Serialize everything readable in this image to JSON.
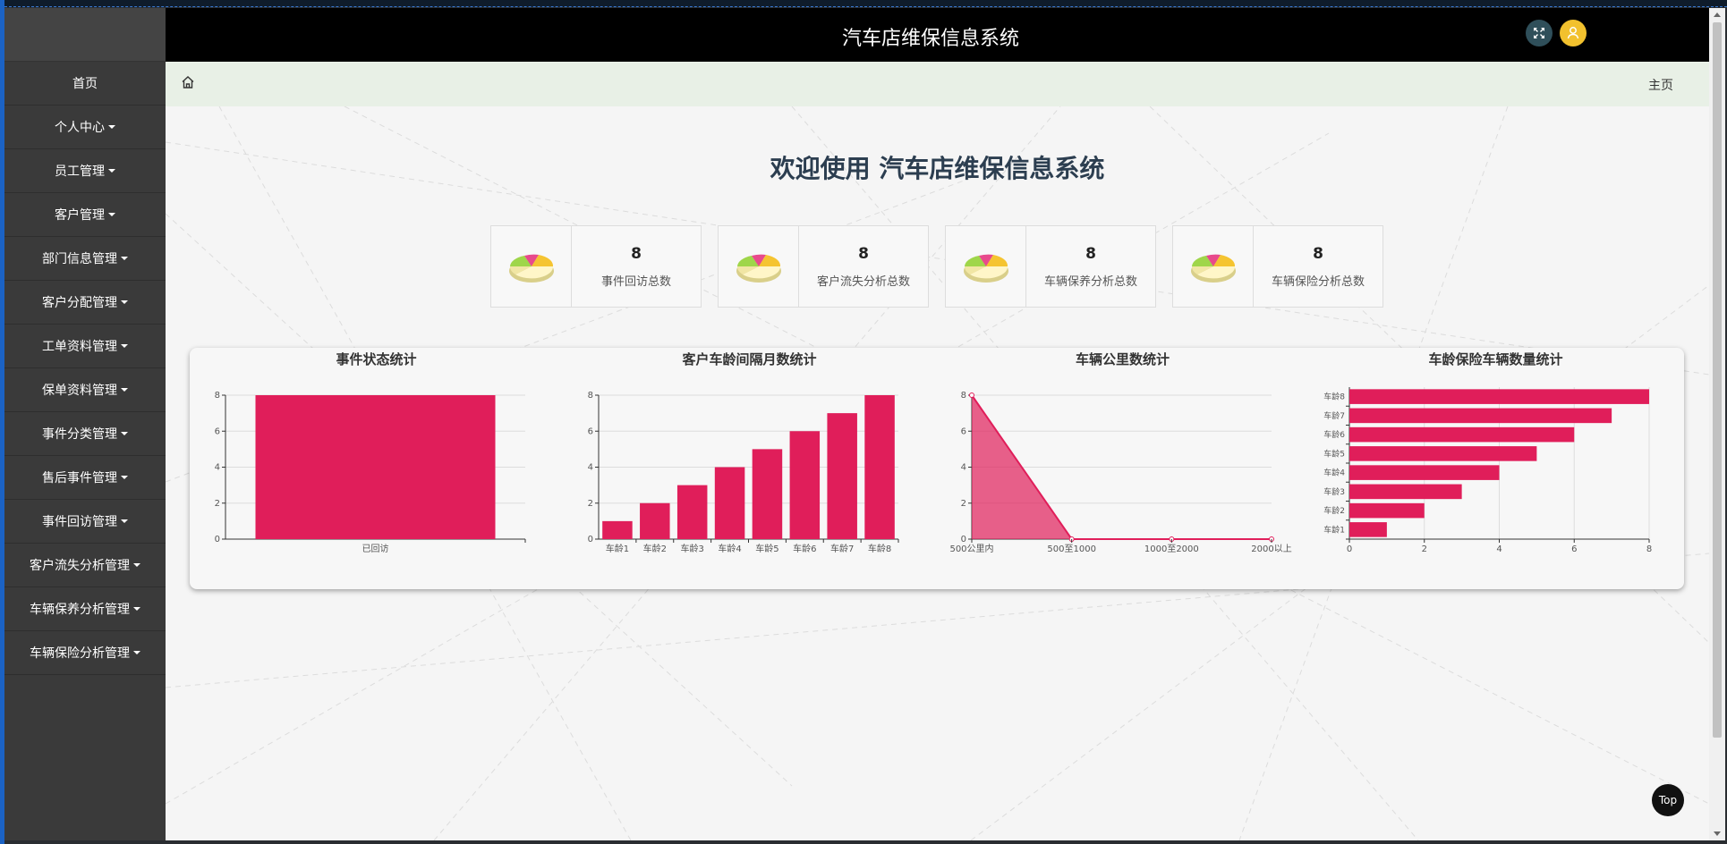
{
  "app": {
    "title": "汽车店维保信息系统",
    "welcome": "欢迎使用 汽车店维保信息系统"
  },
  "header": {
    "icons": [
      "expand-icon",
      "user-icon"
    ]
  },
  "breadcrumb": {
    "home_icon": "home-icon",
    "current": "主页"
  },
  "sidebar": {
    "items": [
      {
        "label": "首页",
        "has_dropdown": false
      },
      {
        "label": "个人中心",
        "has_dropdown": true
      },
      {
        "label": "员工管理",
        "has_dropdown": true
      },
      {
        "label": "客户管理",
        "has_dropdown": true
      },
      {
        "label": "部门信息管理",
        "has_dropdown": true
      },
      {
        "label": "客户分配管理",
        "has_dropdown": true
      },
      {
        "label": "工单资料管理",
        "has_dropdown": true
      },
      {
        "label": "保单资料管理",
        "has_dropdown": true
      },
      {
        "label": "事件分类管理",
        "has_dropdown": true
      },
      {
        "label": "售后事件管理",
        "has_dropdown": true
      },
      {
        "label": "事件回访管理",
        "has_dropdown": true
      },
      {
        "label": "客户流失分析管理",
        "has_dropdown": true
      },
      {
        "label": "车辆保养分析管理",
        "has_dropdown": true
      },
      {
        "label": "车辆保险分析管理",
        "has_dropdown": true
      }
    ]
  },
  "stats": [
    {
      "value": "8",
      "label": "事件回访总数",
      "icon": "pie-chart-icon"
    },
    {
      "value": "8",
      "label": "客户流失分析总数",
      "icon": "pie-chart-icon"
    },
    {
      "value": "8",
      "label": "车辆保养分析总数",
      "icon": "pie-chart-icon"
    },
    {
      "value": "8",
      "label": "车辆保险分析总数",
      "icon": "pie-chart-icon"
    }
  ],
  "colors": {
    "accent": "#e01e5a",
    "header_bg": "#000000",
    "sidebar_bg": "#3a3a3a",
    "breadcrumb_bg": "#e8f0e6"
  },
  "chart_data": [
    {
      "type": "bar",
      "title": "事件状态统计",
      "categories": [
        "已回访"
      ],
      "values": [
        8
      ],
      "ylim": [
        0,
        8
      ],
      "yticks": [
        0,
        2,
        4,
        6,
        8
      ]
    },
    {
      "type": "bar",
      "title": "客户车龄间隔月数统计",
      "categories": [
        "车龄1",
        "车龄2",
        "车龄3",
        "车龄4",
        "车龄5",
        "车龄6",
        "车龄7",
        "车龄8"
      ],
      "values": [
        1,
        2,
        3,
        4,
        5,
        6,
        7,
        8
      ],
      "ylim": [
        0,
        8
      ],
      "yticks": [
        0,
        2,
        4,
        6,
        8
      ]
    },
    {
      "type": "area",
      "title": "车辆公里数统计",
      "categories": [
        "500公里内",
        "500至1000",
        "1000至2000",
        "2000以上"
      ],
      "values": [
        8,
        0,
        0,
        0
      ],
      "ylim": [
        0,
        8
      ],
      "yticks": [
        0,
        2,
        4,
        6,
        8
      ]
    },
    {
      "type": "bar",
      "orientation": "horizontal",
      "title": "车龄保险车辆数量统计",
      "categories": [
        "车龄1",
        "车龄2",
        "车龄3",
        "车龄4",
        "车龄5",
        "车龄6",
        "车龄7",
        "车龄8"
      ],
      "values": [
        1,
        2,
        3,
        4,
        5,
        6,
        7,
        8
      ],
      "xlim": [
        0,
        8
      ],
      "xticks": [
        0,
        2,
        4,
        6,
        8
      ]
    }
  ],
  "top_button": "Top"
}
